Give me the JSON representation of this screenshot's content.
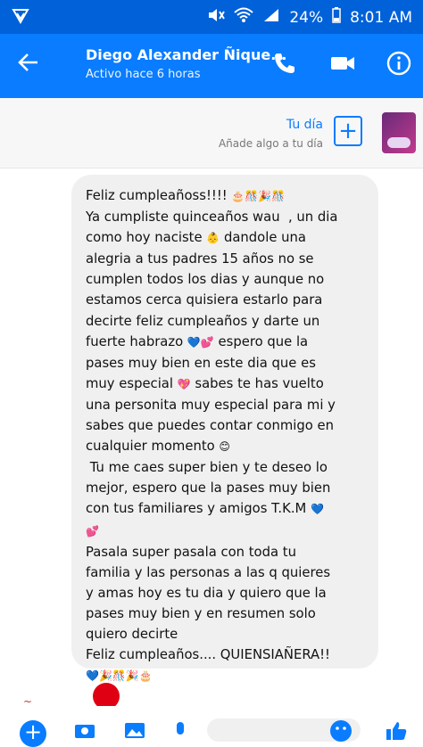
{
  "status": {
    "battery": "24%",
    "time": "8:01 AM"
  },
  "header": {
    "name": "Diego Alexander Ñique...",
    "status": "Activo hace 6 horas"
  },
  "story": {
    "title": "Tu día",
    "subtitle": "Añade algo a tu día"
  },
  "message": {
    "lines": [
      "Feliz cumpleañoss!!!!",
      "Ya cumpliste quinceaños wau  , un dia",
      "como hoy naciste",
      "dandole una",
      "alegria a tus padres 15 años no se",
      "cumplen todos los dias y aunque no",
      "estamos cerca quisiera estarlo para",
      "decirte feliz cumpleaños y darte un",
      "fuerte habrazo",
      "espero que la",
      "pases muy bien en este dia que es",
      "muy especial",
      "sabes te has vuelto",
      "una personita muy especial para mi y",
      "sabes que puedes contar conmigo en",
      "cualquier momento",
      " Tu me caes super bien y te deseo lo",
      "mejor, espero que la pases muy bien",
      "con tus familiares y amigos T.K.M",
      "Pasala super pasala con toda tu",
      "familia y las personas a las q quieres",
      "y amas hoy es tu dia y quiero que la",
      "pases muy bien y en resumen solo",
      "quiero decirte",
      "Feliz cumpleaños.... QUIENSIAÑERA!!"
    ],
    "emojis": {
      "l1": "🎂🎊🎉🎊",
      "l3": "👶",
      "l9a": "💙",
      "l9b": "💕",
      "l12": "💖",
      "l16": "😊",
      "l19": "💙",
      "l20": "💕",
      "last": "💙🎉🎊🎉🎂"
    }
  },
  "colors": {
    "statusbar": "#0061d9",
    "appbar": "#0a7cff",
    "bubble": "#f1f0f0",
    "accent": "#0a7cff"
  },
  "icons": [
    "back-arrow-icon",
    "phone-icon",
    "video-icon",
    "info-icon",
    "plus-icon",
    "camera-icon",
    "image-icon",
    "mic-icon",
    "emoji-icon",
    "thumbs-up-icon"
  ]
}
